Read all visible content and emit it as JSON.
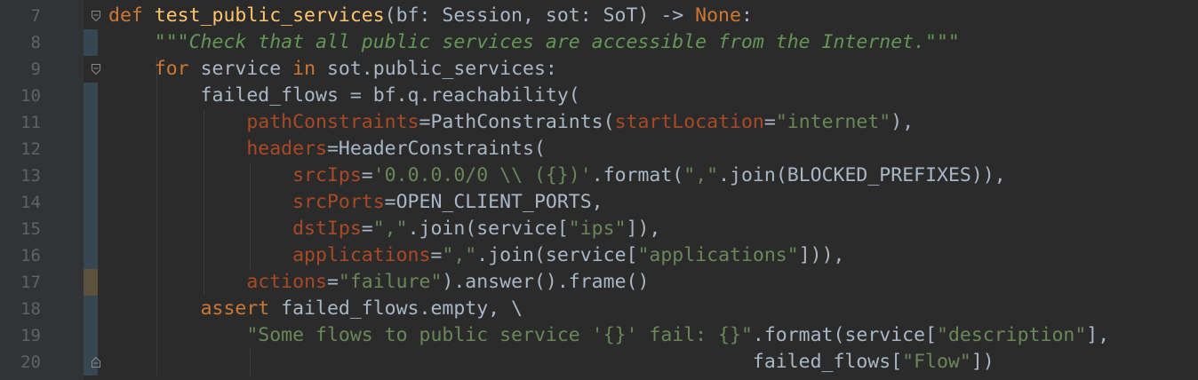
{
  "line_numbers": [
    "7",
    "8",
    "9",
    "10",
    "11",
    "12",
    "13",
    "14",
    "15",
    "16",
    "17",
    "18",
    "19",
    "20"
  ],
  "code": [
    [
      {
        "t": "def ",
        "c": "kw"
      },
      {
        "t": "test_public_services",
        "c": "fn"
      },
      {
        "t": "(bf: Session, sot: SoT) -> ",
        "c": "pl"
      },
      {
        "t": "None",
        "c": "none"
      },
      {
        "t": ":",
        "c": "pl"
      }
    ],
    [
      {
        "t": "    ",
        "c": "pl"
      },
      {
        "t": "\"\"\"Check that all public services are accessible from the Internet.\"\"\"",
        "c": "doc"
      }
    ],
    [
      {
        "t": "    ",
        "c": "pl"
      },
      {
        "t": "for ",
        "c": "kw"
      },
      {
        "t": "service ",
        "c": "pl"
      },
      {
        "t": "in ",
        "c": "kw"
      },
      {
        "t": "sot.public_services:",
        "c": "pl"
      }
    ],
    [
      {
        "t": "        failed_flows = bf.q.reachability(",
        "c": "pl"
      }
    ],
    [
      {
        "t": "            ",
        "c": "pl"
      },
      {
        "t": "pathConstraints",
        "c": "param"
      },
      {
        "t": "=PathConstraints(",
        "c": "pl"
      },
      {
        "t": "startLocation",
        "c": "param"
      },
      {
        "t": "=",
        "c": "pl"
      },
      {
        "t": "\"internet\"",
        "c": "str"
      },
      {
        "t": "),",
        "c": "pl"
      }
    ],
    [
      {
        "t": "            ",
        "c": "pl"
      },
      {
        "t": "headers",
        "c": "param"
      },
      {
        "t": "=HeaderConstraints(",
        "c": "pl"
      }
    ],
    [
      {
        "t": "                ",
        "c": "pl"
      },
      {
        "t": "srcIps",
        "c": "param"
      },
      {
        "t": "=",
        "c": "pl"
      },
      {
        "t": "'0.0.0.0/0 \\\\ ({})'",
        "c": "str"
      },
      {
        "t": ".format(",
        "c": "pl"
      },
      {
        "t": "\",\"",
        "c": "str"
      },
      {
        "t": ".join(BLOCKED_PREFIXES)),",
        "c": "pl"
      }
    ],
    [
      {
        "t": "                ",
        "c": "pl"
      },
      {
        "t": "srcPorts",
        "c": "param"
      },
      {
        "t": "=OPEN_CLIENT_PORTS,",
        "c": "pl"
      }
    ],
    [
      {
        "t": "                ",
        "c": "pl"
      },
      {
        "t": "dstIps",
        "c": "param"
      },
      {
        "t": "=",
        "c": "pl"
      },
      {
        "t": "\",\"",
        "c": "str"
      },
      {
        "t": ".join(service[",
        "c": "pl"
      },
      {
        "t": "\"ips\"",
        "c": "str"
      },
      {
        "t": "]),",
        "c": "pl"
      }
    ],
    [
      {
        "t": "                ",
        "c": "pl"
      },
      {
        "t": "applications",
        "c": "param"
      },
      {
        "t": "=",
        "c": "pl"
      },
      {
        "t": "\",\"",
        "c": "str"
      },
      {
        "t": ".join(service[",
        "c": "pl"
      },
      {
        "t": "\"applications\"",
        "c": "str"
      },
      {
        "t": "])),",
        "c": "pl"
      }
    ],
    [
      {
        "t": "            ",
        "c": "pl"
      },
      {
        "t": "actions",
        "c": "param"
      },
      {
        "t": "=",
        "c": "pl"
      },
      {
        "t": "\"failure\"",
        "c": "str"
      },
      {
        "t": ").answer().frame()",
        "c": "pl"
      }
    ],
    [
      {
        "t": "        ",
        "c": "pl"
      },
      {
        "t": "assert ",
        "c": "kw"
      },
      {
        "t": "failed_flows.empty, \\",
        "c": "pl"
      }
    ],
    [
      {
        "t": "            ",
        "c": "pl"
      },
      {
        "t": "\"Some flows to public service '{}' fail: {}\"",
        "c": "str"
      },
      {
        "t": ".format(service[",
        "c": "pl"
      },
      {
        "t": "\"description\"",
        "c": "str"
      },
      {
        "t": "],",
        "c": "pl"
      }
    ],
    [
      {
        "t": "                                                        failed_flows[",
        "c": "pl"
      },
      {
        "t": "\"Flow\"",
        "c": "str"
      },
      {
        "t": "])",
        "c": "pl"
      }
    ]
  ],
  "colors": {
    "background": "#2b2b2b",
    "gutter": "#313335",
    "keyword": "#cc7832",
    "function": "#ffc66d",
    "string": "#6a8759",
    "docstring": "#629755",
    "parameter": "#aa4926",
    "text": "#a9b7c6",
    "line_number": "#606366",
    "vcs_modified": "#374752",
    "vcs_changed": "#5c523b"
  },
  "gutter_markers": [
    {
      "line": "7",
      "icon": "fold-open-icon"
    },
    {
      "line": "9",
      "icon": "fold-open-icon"
    },
    {
      "line": "20",
      "icon": "fold-close-icon"
    }
  ]
}
